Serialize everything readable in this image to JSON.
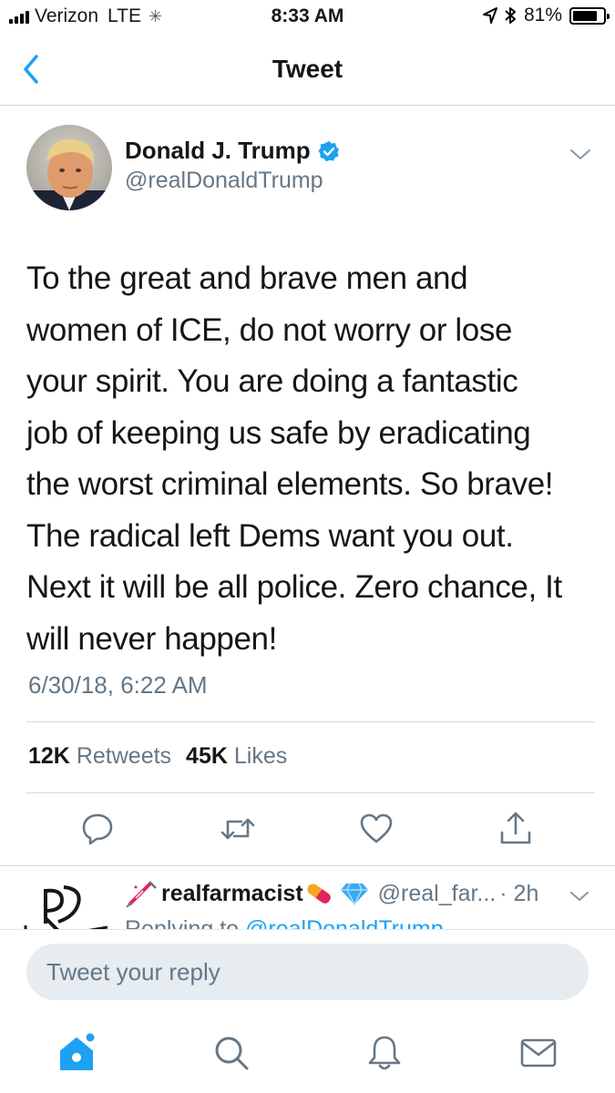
{
  "status_bar": {
    "carrier": "Verizon",
    "network": "LTE",
    "time": "8:33 AM",
    "battery": "81%",
    "battery_level": 0.81
  },
  "nav": {
    "title": "Tweet",
    "back_icon": "chevron-left-icon"
  },
  "tweet": {
    "author_name": "Donald J. Trump",
    "author_handle": "@realDonaldTrump",
    "text_lines": [
      "To the great and brave men and",
      "women of ICE, do not worry or lose",
      "your spirit. You are doing a fantastic",
      "job of keeping us safe by eradicating",
      "the worst criminal elements. So brave!",
      "The radical left Dems want you out.",
      "Next it will be all police. Zero chance, It",
      "will never happen!"
    ],
    "timestamp": "6/30/18, 6:22 AM",
    "retweets_count": "12K",
    "retweets_label": "Retweets",
    "likes_count": "45K",
    "likes_label": "Likes"
  },
  "actions": [
    "reply-icon",
    "retweet-icon",
    "like-icon",
    "share-icon"
  ],
  "reply_preview": {
    "name": "realfarmacist",
    "handle": "@real_far...",
    "time": "· 2h",
    "replying_prefix": "Replying to",
    "replying_to": "@realDonaldTrump"
  },
  "compose": {
    "placeholder": "Tweet your reply"
  },
  "tab_bar": [
    "home-icon",
    "search-icon",
    "notifications-icon",
    "messages-icon"
  ],
  "colors": {
    "accent": "#1da1f2",
    "secondary_text": "#657786",
    "verified": "#1da1f2",
    "divider": "#d5d9dd"
  }
}
